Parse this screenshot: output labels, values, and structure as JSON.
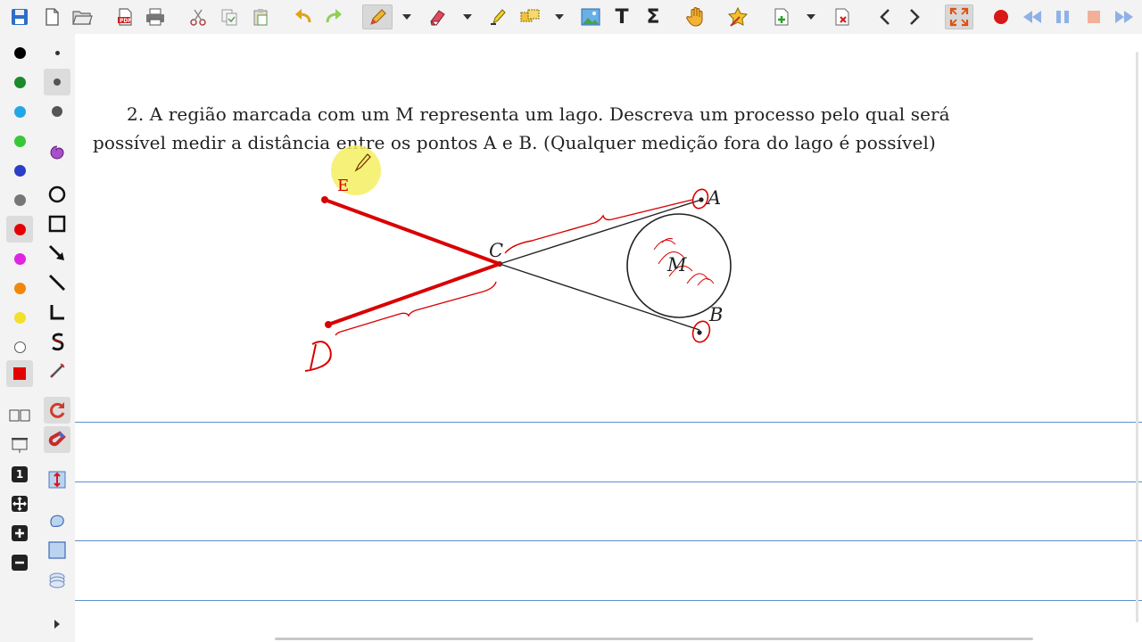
{
  "toolbar": {
    "icons": [
      "save-icon",
      "new-page-icon",
      "open-folder-icon",
      "export-pdf-icon",
      "print-icon",
      "cut-icon",
      "copy-icon",
      "paste-icon",
      "undo-icon",
      "redo-icon",
      "pen-tool-icon",
      "eraser-icon",
      "highlighter-icon",
      "select-region-icon",
      "insert-image-icon",
      "text-tool-icon",
      "sum-tool-icon",
      "hand-tool-icon",
      "select-object-icon",
      "add-page-icon",
      "delete-page-icon",
      "previous-page-icon",
      "next-page-icon",
      "fullscreen-icon",
      "record-icon",
      "rewind-icon",
      "pause-icon",
      "stop-icon",
      "fast-forward-icon"
    ],
    "pdf_badge": "PDF",
    "text_glyph": "T",
    "sum_glyph": "Σ"
  },
  "colors": {
    "palette": [
      "#000000",
      "#1a8a2a",
      "#22a7e6",
      "#39c739",
      "#2b3ec8",
      "#777777",
      "#e30000",
      "#e025e0",
      "#f0880c",
      "#f2e02a",
      "#ffffff",
      "#e30000"
    ],
    "accent_red": "#d90000",
    "highlight_yellow": "#f5f062",
    "rule_blue": "#5b8fd0"
  },
  "sidebar": {
    "sizes": [
      "small",
      "medium",
      "large"
    ],
    "shapes": [
      "lasso-icon",
      "circle-shape-icon",
      "rectangle-shape-icon",
      "arrow-shape-icon",
      "line-shape-icon",
      "angle-shape-icon",
      "curve-shape-icon",
      "ruler-icon"
    ],
    "page_number": "1"
  },
  "content": {
    "problem_line1": "2.  A região marcada com um M representa um lago.  Descreva um processo pelo qual será",
    "problem_line2": "possível medir a distância entre os pontos A e B.  (Qualquer medição fora do lago é possível)",
    "label_a": "A",
    "label_b": "B",
    "label_c": "C",
    "label_m": "M",
    "label_d": "D",
    "label_e": "E"
  }
}
